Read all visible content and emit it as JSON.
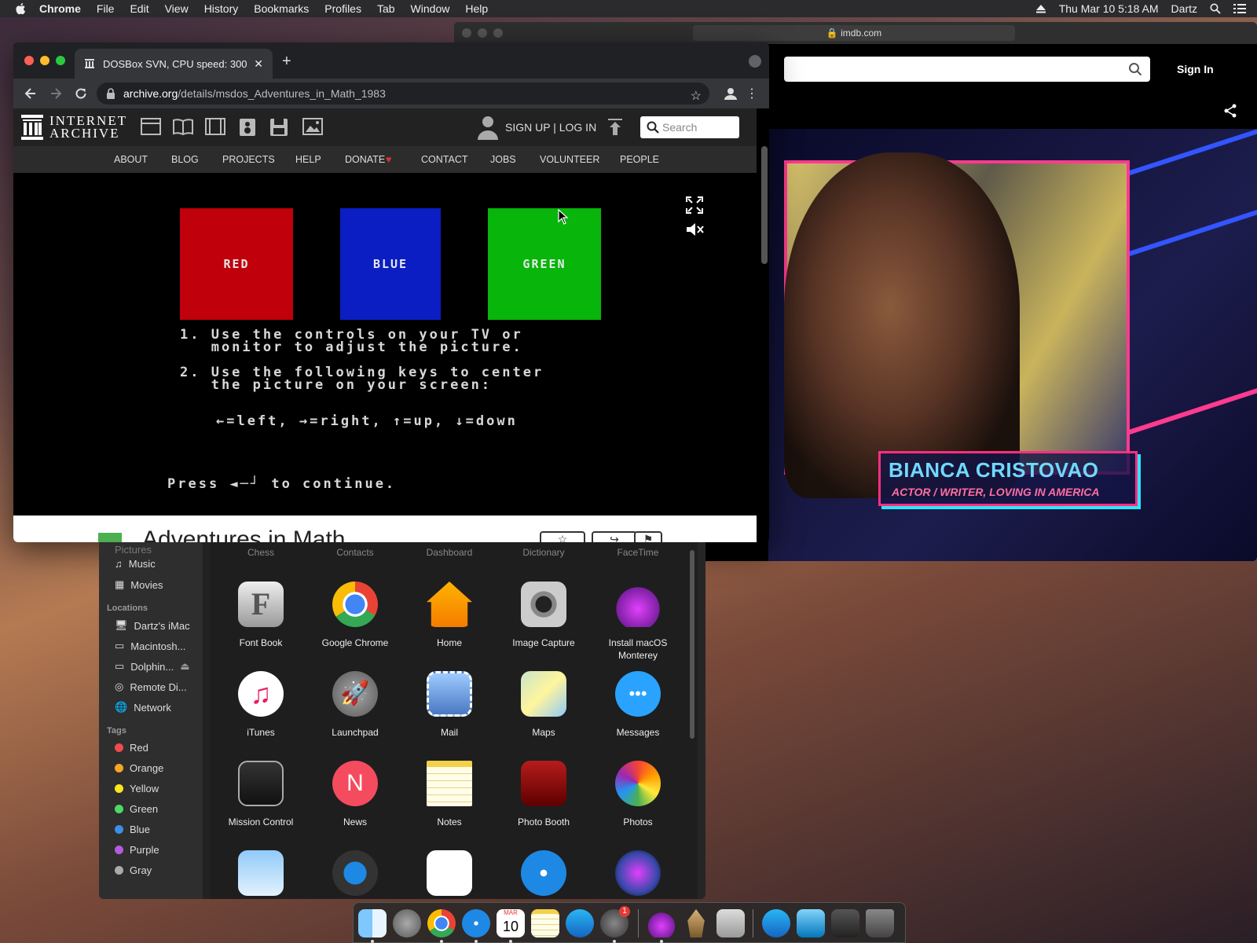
{
  "menubar": {
    "app_name": "Chrome",
    "items": [
      "File",
      "Edit",
      "View",
      "History",
      "Bookmarks",
      "Profiles",
      "Tab",
      "Window",
      "Help"
    ],
    "clock": "Thu Mar 10  5:18 AM",
    "user": "Dartz"
  },
  "safari": {
    "url": "imdb.com",
    "sign_in": "Sign In",
    "video": {
      "name": "BIANCA CRISTOVAO",
      "role": "ACTOR / WRITER, LOVING IN AMERICA"
    }
  },
  "chrome": {
    "tab_title": "DOSBox SVN, CPU speed: 300",
    "url_host": "archive.org",
    "url_path": "/details/msdos_Adventures_in_Math_1983"
  },
  "ia": {
    "logo_line1": "INTERNET",
    "logo_line2": "ARCHIVE",
    "signup": "SIGN UP | LOG IN",
    "search_placeholder": "Search",
    "nav": [
      "ABOUT",
      "BLOG",
      "PROJECTS",
      "HELP",
      "DONATE",
      "CONTACT",
      "JOBS",
      "VOLUNTEER",
      "PEOPLE"
    ],
    "item_title": "Adventures in Math"
  },
  "dos": {
    "swatches": [
      {
        "label": "RED",
        "color": "#c0000b"
      },
      {
        "label": "BLUE",
        "color": "#0a1ec4"
      },
      {
        "label": "GREEN",
        "color": "#08b50a"
      }
    ],
    "line1a": "1. Use the controls on your TV or",
    "line1b": "   monitor to adjust the picture.",
    "line2a": "2. Use the following keys to center",
    "line2b": "   the picture on your screen:",
    "keys": "←=left, →=right, ↑=up, ↓=down",
    "press": "Press ◄─┘ to continue."
  },
  "finder": {
    "sidebar": {
      "partial_top": "Pictures",
      "favorites_tail": [
        "Music",
        "Movies"
      ],
      "locations_header": "Locations",
      "locations": [
        "Dartz's iMac",
        "Macintosh...",
        "Dolphin...",
        "Remote Di...",
        "Network"
      ],
      "tags_header": "Tags",
      "tags": [
        {
          "name": "Red",
          "color": "#ef4b4b"
        },
        {
          "name": "Orange",
          "color": "#f5a623"
        },
        {
          "name": "Yellow",
          "color": "#f8e71c"
        },
        {
          "name": "Green",
          "color": "#4cd964"
        },
        {
          "name": "Blue",
          "color": "#3b8fe6"
        },
        {
          "name": "Purple",
          "color": "#b35be0"
        },
        {
          "name": "Gray",
          "color": "#aaaaaa"
        }
      ]
    },
    "top_row": [
      "Chess",
      "Contacts",
      "Dashboard",
      "Dictionary",
      "FaceTime"
    ],
    "apps_row1": [
      "Font Book",
      "Google Chrome",
      "Home",
      "Image Capture",
      "Install macOS Monterey"
    ],
    "apps_row2": [
      "iTunes",
      "Launchpad",
      "Mail",
      "Maps",
      "Messages"
    ],
    "apps_row3": [
      "Mission Control",
      "News",
      "Notes",
      "Photo Booth",
      "Photos"
    ]
  },
  "dock": {
    "calendar_day": "10",
    "calendar_month": "MAR",
    "badge": "1"
  }
}
